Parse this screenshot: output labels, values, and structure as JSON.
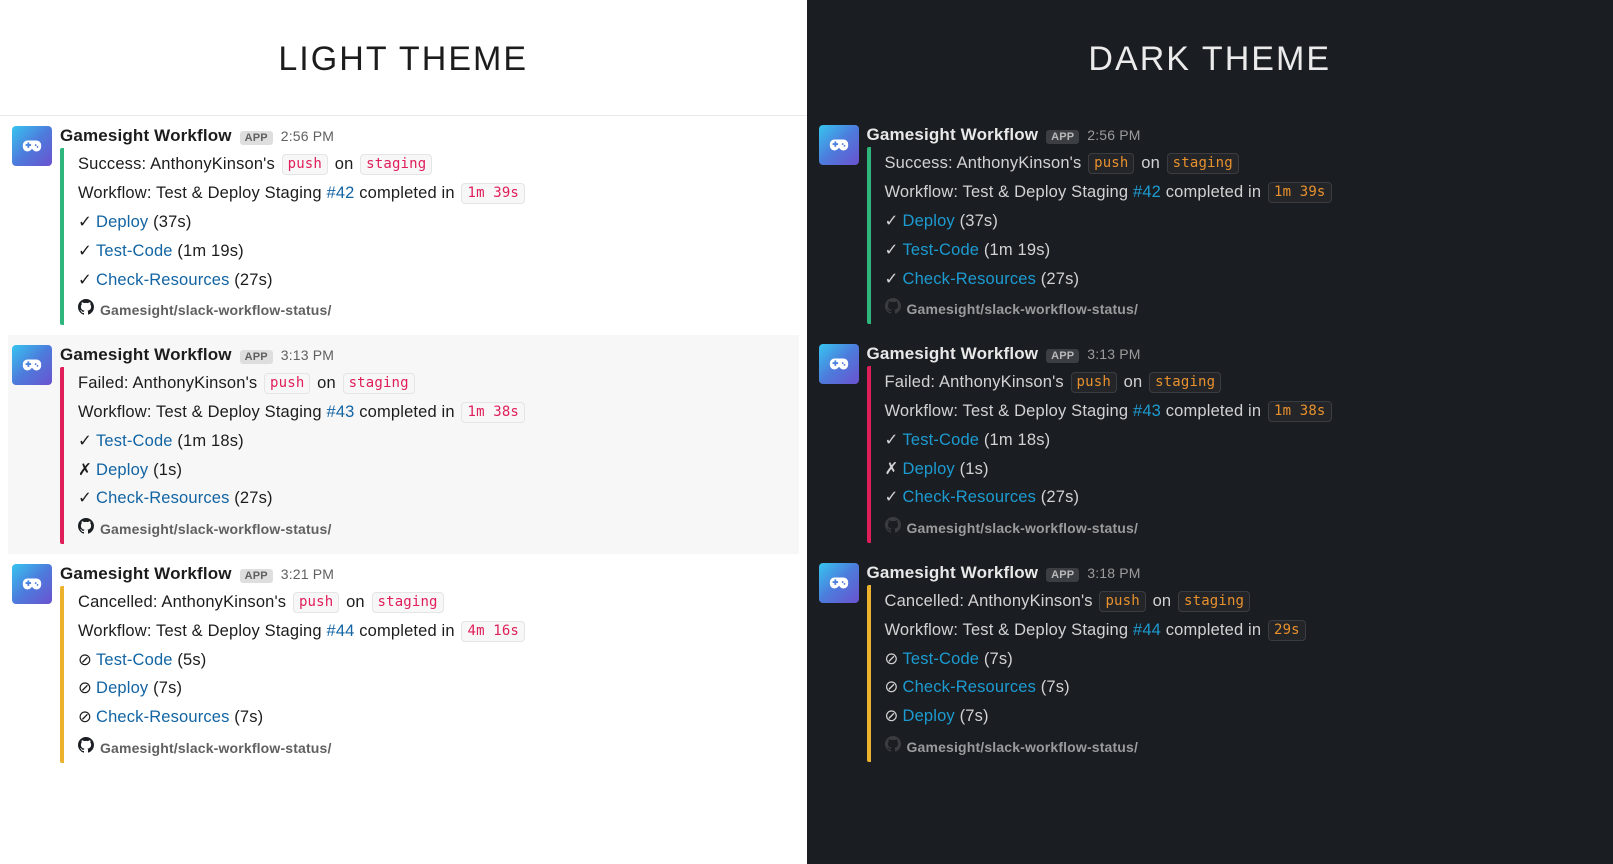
{
  "light": {
    "title": "LIGHT THEME",
    "messages": [
      {
        "sender": "Gamesight Workflow",
        "badge": "APP",
        "ts": "2:56 PM",
        "bar": "green",
        "status_verb": "Success:",
        "actor": "AnthonyKinson's",
        "event": "push",
        "on_word": "on",
        "branch": "staging",
        "wf_prefix": "Workflow:",
        "wf_name": "Test & Deploy Staging",
        "run_num": "#42",
        "completed": "completed in",
        "duration": "1m 39s",
        "jobs": [
          {
            "icon": "✓",
            "name": "Deploy",
            "dur": "(37s)"
          },
          {
            "icon": "✓",
            "name": "Test-Code",
            "dur": "(1m 19s)"
          },
          {
            "icon": "✓",
            "name": "Check-Resources",
            "dur": "(27s)"
          }
        ],
        "repo": "Gamesight/slack-workflow-status/"
      },
      {
        "sender": "Gamesight Workflow",
        "badge": "APP",
        "ts": "3:13 PM",
        "bar": "red",
        "status_verb": "Failed:",
        "actor": "AnthonyKinson's",
        "event": "push",
        "on_word": "on",
        "branch": "staging",
        "wf_prefix": "Workflow:",
        "wf_name": "Test & Deploy Staging",
        "run_num": "#43",
        "completed": "completed in",
        "duration": "1m 38s",
        "jobs": [
          {
            "icon": "✓",
            "name": "Test-Code",
            "dur": "(1m 18s)"
          },
          {
            "icon": "✗",
            "name": "Deploy",
            "dur": "(1s)"
          },
          {
            "icon": "✓",
            "name": "Check-Resources",
            "dur": "(27s)"
          }
        ],
        "repo": "Gamesight/slack-workflow-status/"
      },
      {
        "sender": "Gamesight Workflow",
        "badge": "APP",
        "ts": "3:21 PM",
        "bar": "yellow",
        "status_verb": "Cancelled:",
        "actor": "AnthonyKinson's",
        "event": "push",
        "on_word": "on",
        "branch": "staging",
        "wf_prefix": "Workflow:",
        "wf_name": "Test & Deploy Staging",
        "run_num": "#44",
        "completed": "completed in",
        "duration": "4m 16s",
        "jobs": [
          {
            "icon": "⊘",
            "name": "Test-Code",
            "dur": "(5s)"
          },
          {
            "icon": "⊘",
            "name": "Deploy",
            "dur": "(7s)"
          },
          {
            "icon": "⊘",
            "name": "Check-Resources",
            "dur": "(7s)"
          }
        ],
        "repo": "Gamesight/slack-workflow-status/"
      }
    ]
  },
  "dark": {
    "title": "DARK THEME",
    "messages": [
      {
        "sender": "Gamesight Workflow",
        "badge": "APP",
        "ts": "2:56 PM",
        "bar": "green",
        "status_verb": "Success:",
        "actor": "AnthonyKinson's",
        "event": "push",
        "on_word": "on",
        "branch": "staging",
        "wf_prefix": "Workflow:",
        "wf_name": "Test & Deploy Staging",
        "run_num": "#42",
        "completed": "completed in",
        "duration": "1m 39s",
        "jobs": [
          {
            "icon": "✓",
            "name": "Deploy",
            "dur": "(37s)"
          },
          {
            "icon": "✓",
            "name": "Test-Code",
            "dur": "(1m 19s)"
          },
          {
            "icon": "✓",
            "name": "Check-Resources",
            "dur": "(27s)"
          }
        ],
        "repo": "Gamesight/slack-workflow-status/"
      },
      {
        "sender": "Gamesight Workflow",
        "badge": "APP",
        "ts": "3:13 PM",
        "bar": "red",
        "status_verb": "Failed:",
        "actor": "AnthonyKinson's",
        "event": "push",
        "on_word": "on",
        "branch": "staging",
        "wf_prefix": "Workflow:",
        "wf_name": "Test & Deploy Staging",
        "run_num": "#43",
        "completed": "completed in",
        "duration": "1m 38s",
        "jobs": [
          {
            "icon": "✓",
            "name": "Test-Code",
            "dur": "(1m 18s)"
          },
          {
            "icon": "✗",
            "name": "Deploy",
            "dur": "(1s)"
          },
          {
            "icon": "✓",
            "name": "Check-Resources",
            "dur": "(27s)"
          }
        ],
        "repo": "Gamesight/slack-workflow-status/"
      },
      {
        "sender": "Gamesight Workflow",
        "badge": "APP",
        "ts": "3:18 PM",
        "bar": "yellow",
        "status_verb": "Cancelled:",
        "actor": "AnthonyKinson's",
        "event": "push",
        "on_word": "on",
        "branch": "staging",
        "wf_prefix": "Workflow:",
        "wf_name": "Test & Deploy Staging",
        "run_num": "#44",
        "completed": "completed in",
        "duration": "29s",
        "jobs": [
          {
            "icon": "⊘",
            "name": "Test-Code",
            "dur": "(7s)"
          },
          {
            "icon": "⊘",
            "name": "Check-Resources",
            "dur": "(7s)"
          },
          {
            "icon": "⊘",
            "name": "Deploy",
            "dur": "(7s)"
          }
        ],
        "repo": "Gamesight/slack-workflow-status/"
      }
    ]
  }
}
